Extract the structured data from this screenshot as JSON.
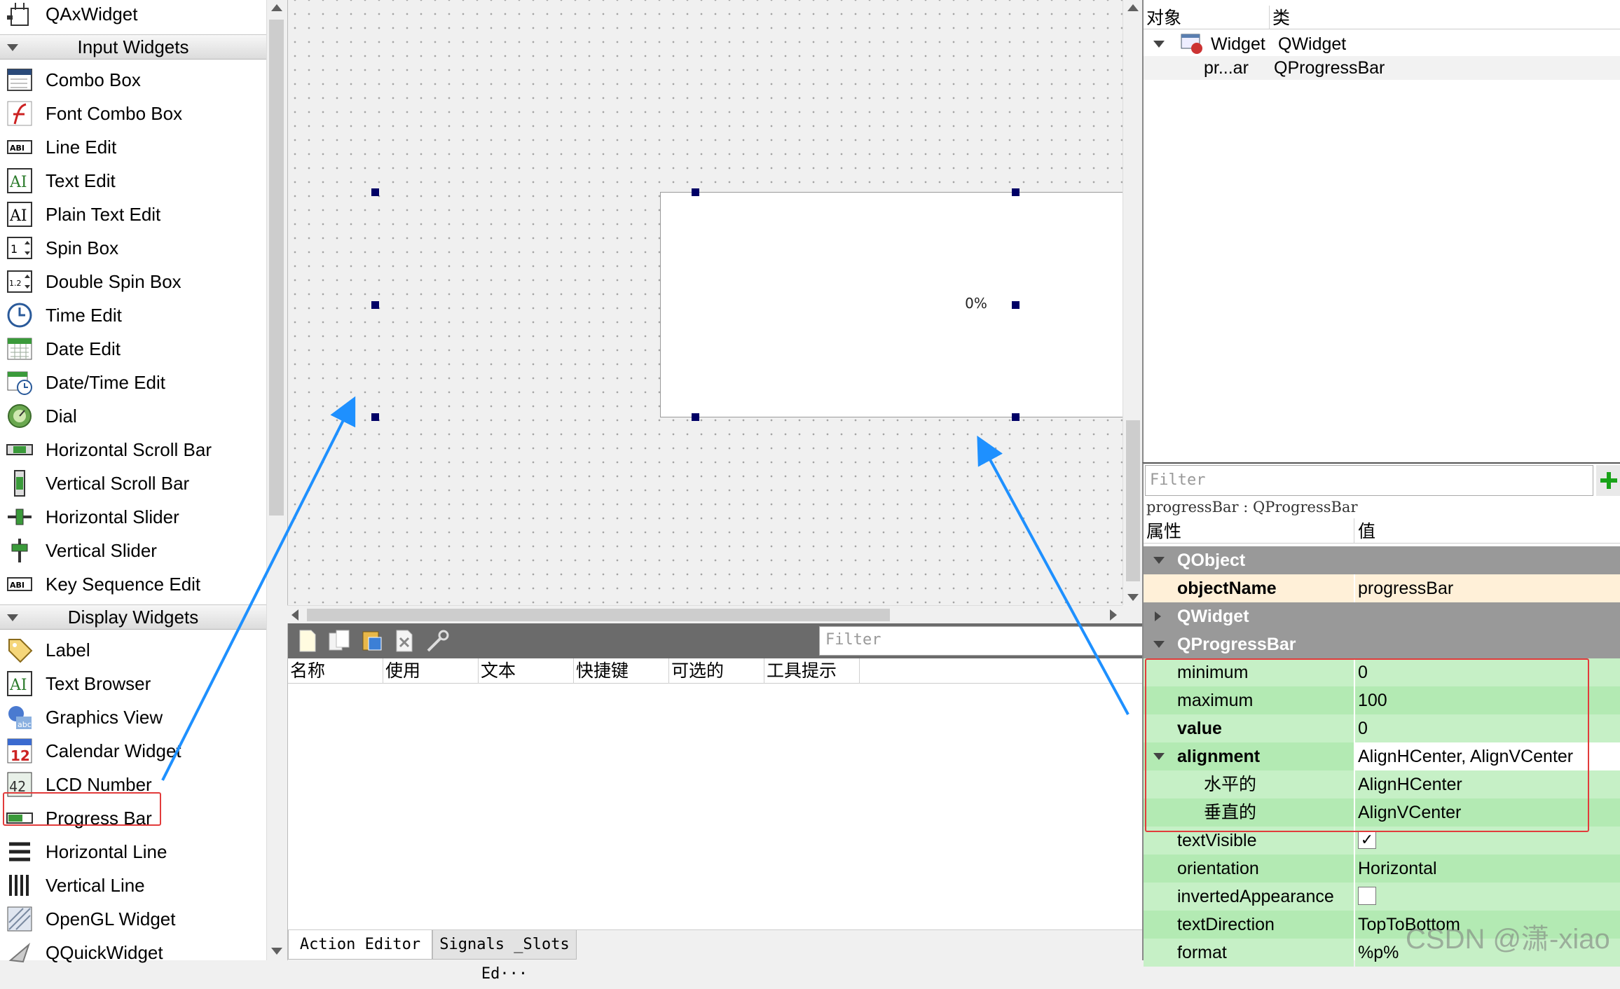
{
  "widget_box": {
    "top_item": {
      "label": "QAxWidget",
      "icon": "qaxwidget-icon"
    },
    "categories": [
      {
        "label": "Input Widgets",
        "items": [
          {
            "label": "Combo Box",
            "icon": "combo-box-icon"
          },
          {
            "label": "Font Combo Box",
            "icon": "font-combo-box-icon"
          },
          {
            "label": "Line Edit",
            "icon": "line-edit-icon"
          },
          {
            "label": "Text Edit",
            "icon": "text-edit-icon"
          },
          {
            "label": "Plain Text Edit",
            "icon": "plain-text-edit-icon"
          },
          {
            "label": "Spin Box",
            "icon": "spin-box-icon"
          },
          {
            "label": "Double Spin Box",
            "icon": "double-spin-box-icon"
          },
          {
            "label": "Time Edit",
            "icon": "time-edit-icon"
          },
          {
            "label": "Date Edit",
            "icon": "date-edit-icon"
          },
          {
            "label": "Date/Time Edit",
            "icon": "date-time-edit-icon"
          },
          {
            "label": "Dial",
            "icon": "dial-icon"
          },
          {
            "label": "Horizontal Scroll Bar",
            "icon": "horizontal-scroll-bar-icon"
          },
          {
            "label": "Vertical Scroll Bar",
            "icon": "vertical-scroll-bar-icon"
          },
          {
            "label": "Horizontal Slider",
            "icon": "horizontal-slider-icon"
          },
          {
            "label": "Vertical Slider",
            "icon": "vertical-slider-icon"
          },
          {
            "label": "Key Sequence Edit",
            "icon": "key-sequence-edit-icon"
          }
        ]
      },
      {
        "label": "Display Widgets",
        "items": [
          {
            "label": "Label",
            "icon": "label-icon"
          },
          {
            "label": "Text Browser",
            "icon": "text-browser-icon"
          },
          {
            "label": "Graphics View",
            "icon": "graphics-view-icon"
          },
          {
            "label": "Calendar Widget",
            "icon": "calendar-widget-icon"
          },
          {
            "label": "LCD Number",
            "icon": "lcd-number-icon"
          },
          {
            "label": "Progress Bar",
            "icon": "progress-bar-icon"
          },
          {
            "label": "Horizontal Line",
            "icon": "horizontal-line-icon"
          },
          {
            "label": "Vertical Line",
            "icon": "vertical-line-icon"
          },
          {
            "label": "OpenGL Widget",
            "icon": "opengl-widget-icon"
          },
          {
            "label": "QQuickWidget",
            "icon": "qquickwidget-icon"
          }
        ]
      }
    ]
  },
  "canvas": {
    "progress_text": "0%",
    "progress_value": 0
  },
  "action_editor": {
    "filter_placeholder": "Filter",
    "columns": [
      "名称",
      "使用",
      "文本",
      "快捷键",
      "可选的",
      "工具提示"
    ],
    "tabs": [
      "Action Editor",
      "Signals _Slots Ed···"
    ],
    "toolbar_icons": [
      "new-action-icon",
      "copy-action-icon",
      "paste-action-icon",
      "delete-action-icon",
      "configure-icon"
    ]
  },
  "object_inspector": {
    "col_object": "对象",
    "col_class": "类",
    "rows": [
      {
        "object": "Widget",
        "class": "QWidget"
      },
      {
        "object": "pr...ar",
        "class": "QProgressBar"
      }
    ]
  },
  "property_editor": {
    "filter_placeholder": "Filter",
    "object_label": "progressBar : QProgressBar",
    "col_property": "属性",
    "col_value": "值",
    "groups": {
      "qobject": "QObject",
      "qwidget": "QWidget",
      "qprogressbar": "QProgressBar"
    },
    "props": {
      "objectName": {
        "name": "objectName",
        "value": "progressBar"
      },
      "minimum": {
        "name": "minimum",
        "value": "0"
      },
      "maximum": {
        "name": "maximum",
        "value": "100"
      },
      "value": {
        "name": "value",
        "value": "0"
      },
      "alignment": {
        "name": "alignment",
        "value": "AlignHCenter, AlignVCenter"
      },
      "horizontal": {
        "name": "水平的",
        "value": "AlignHCenter"
      },
      "vertical": {
        "name": "垂直的",
        "value": "AlignVCenter"
      },
      "textVisible": {
        "name": "textVisible",
        "value": "✓"
      },
      "orientation": {
        "name": "orientation",
        "value": "Horizontal"
      },
      "invertedAppearance": {
        "name": "invertedAppearance",
        "value": ""
      },
      "textDirection": {
        "name": "textDirection",
        "value": "TopToBottom"
      },
      "format": {
        "name": "format",
        "value": "%p%"
      }
    }
  },
  "watermark": "CSDN @潇-xiao",
  "colors": {
    "highlight_red": "#e23b3b",
    "arrow_blue": "#1e90ff",
    "property_green": "#c6f0c6",
    "property_yellow": "#fff0d8",
    "group_gray": "#999999",
    "handle_navy": "#000066"
  }
}
